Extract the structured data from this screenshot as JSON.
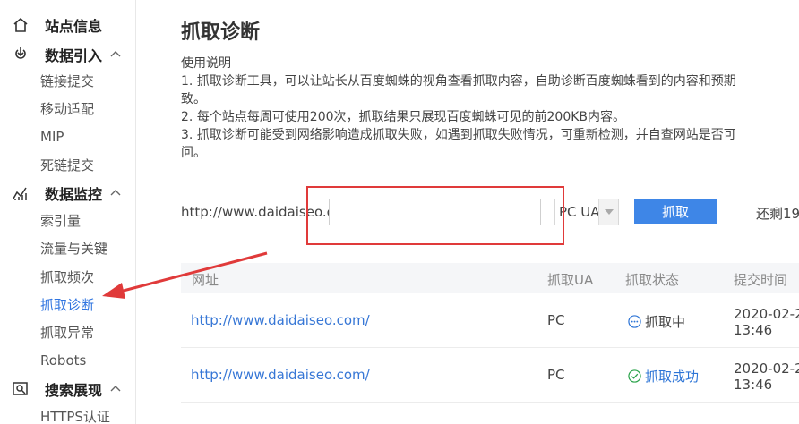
{
  "sidebar": {
    "sections": [
      {
        "label": "站点信息",
        "icon": "home-icon"
      },
      {
        "label": "数据引入",
        "icon": "data-import-icon"
      },
      {
        "label": "数据监控",
        "icon": "monitor-icon"
      },
      {
        "label": "搜索展现",
        "icon": "search-display-icon"
      }
    ],
    "items": {
      "import": [
        "链接提交",
        "移动适配",
        "MIP",
        "死链提交"
      ],
      "monitor": [
        "索引量",
        "流量与关键",
        "抓取频次",
        "抓取诊断",
        "抓取异常",
        "Robots"
      ],
      "display": [
        "HTTPS认证"
      ]
    },
    "active_item": "抓取诊断"
  },
  "main": {
    "title": "抓取诊断",
    "usage": {
      "heading": "使用说明",
      "lines": [
        "1. 抓取诊断工具，可以让站长从百度蜘蛛的视角查看抓取内容，自助诊断百度蜘蛛看到的内容和预期",
        "致。",
        "2. 每个站点每周可使用200次，抓取结果只展现百度蜘蛛可见的前200KB内容。",
        "3. 抓取诊断可能受到网络影响造成抓取失败，如遇到抓取失败情况，可重新检测，并自查网站是否可",
        "问。"
      ]
    },
    "form": {
      "url_prefix": "http://www.daidaiseo.com/",
      "url_value": "",
      "ua_value": "PC UA",
      "fetch_label": "抓取",
      "remaining": "还剩19"
    },
    "table": {
      "headers": [
        "网址",
        "抓取UA",
        "抓取状态",
        "提交时间"
      ],
      "rows": [
        {
          "url": "http://www.daidaiseo.com/",
          "ua": "PC",
          "status": "抓取中",
          "status_type": "pending",
          "date": "2020-02-2",
          "time": "13:46"
        },
        {
          "url": "http://www.daidaiseo.com/",
          "ua": "PC",
          "status": "抓取成功",
          "status_type": "success",
          "date": "2020-02-2",
          "time": "13:46"
        }
      ]
    }
  },
  "colors": {
    "accent": "#3e86e7",
    "link": "#3777d6",
    "annotation": "#e03a3a"
  }
}
